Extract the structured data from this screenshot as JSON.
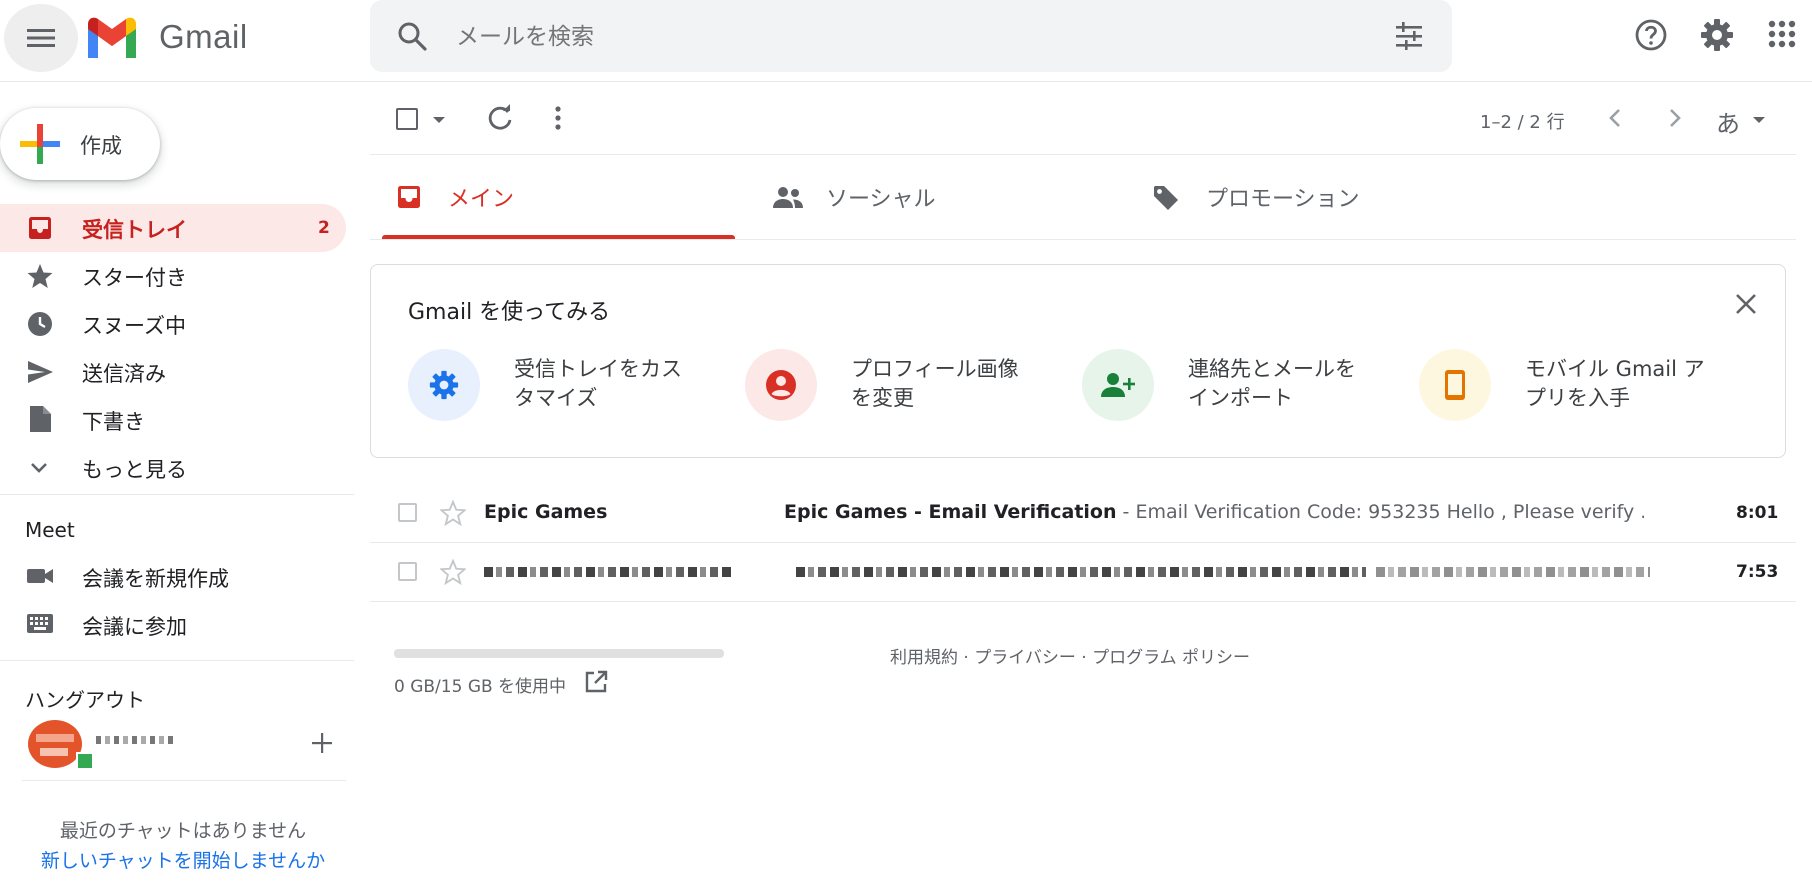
{
  "app": {
    "brand": "Gmail"
  },
  "search": {
    "placeholder": "メールを検索"
  },
  "compose": {
    "label": "作成"
  },
  "sidebar": {
    "items": [
      {
        "label": "受信トレイ",
        "count": "2"
      },
      {
        "label": "スター付き"
      },
      {
        "label": "スヌーズ中"
      },
      {
        "label": "送信済み"
      },
      {
        "label": "下書き"
      },
      {
        "label": "もっと見る"
      }
    ]
  },
  "meet": {
    "title": "Meet",
    "items": [
      {
        "label": "会議を新規作成"
      },
      {
        "label": "会議に参加"
      }
    ]
  },
  "hangouts": {
    "title": "ハングアウト",
    "empty_text": "最近のチャットはありません",
    "start_link": "新しいチャットを開始しませんか"
  },
  "toolbar": {
    "range": "1–2 / 2 行",
    "input_tool": "あ"
  },
  "tabs": [
    {
      "label": "メイン"
    },
    {
      "label": "ソーシャル"
    },
    {
      "label": "プロモーション"
    }
  ],
  "getting_started": {
    "title": "Gmail を使ってみる",
    "items": [
      {
        "line1": "受信トレイをカス",
        "line2": "タマイズ"
      },
      {
        "line1": "プロフィール画像",
        "line2": "を変更"
      },
      {
        "line1": "連絡先とメールを",
        "line2": "インポート"
      },
      {
        "line1": "モバイル Gmail ア",
        "line2": "プリを入手"
      }
    ]
  },
  "emails": [
    {
      "sender": "Epic Games",
      "subject": "Epic Games - Email Verification",
      "snippet": " - Email Verification Code: 953235 Hello , Please verify ...",
      "time": "8:01"
    },
    {
      "time": "7:53"
    }
  ],
  "footer": {
    "storage": "0 GB/15 GB を使用中",
    "policy": "利用規約 · プライバシー · プログラム ポリシー"
  },
  "colors": {
    "accent": "#d93025",
    "active_bg": "#fce8e6",
    "link": "#1a73e8"
  }
}
